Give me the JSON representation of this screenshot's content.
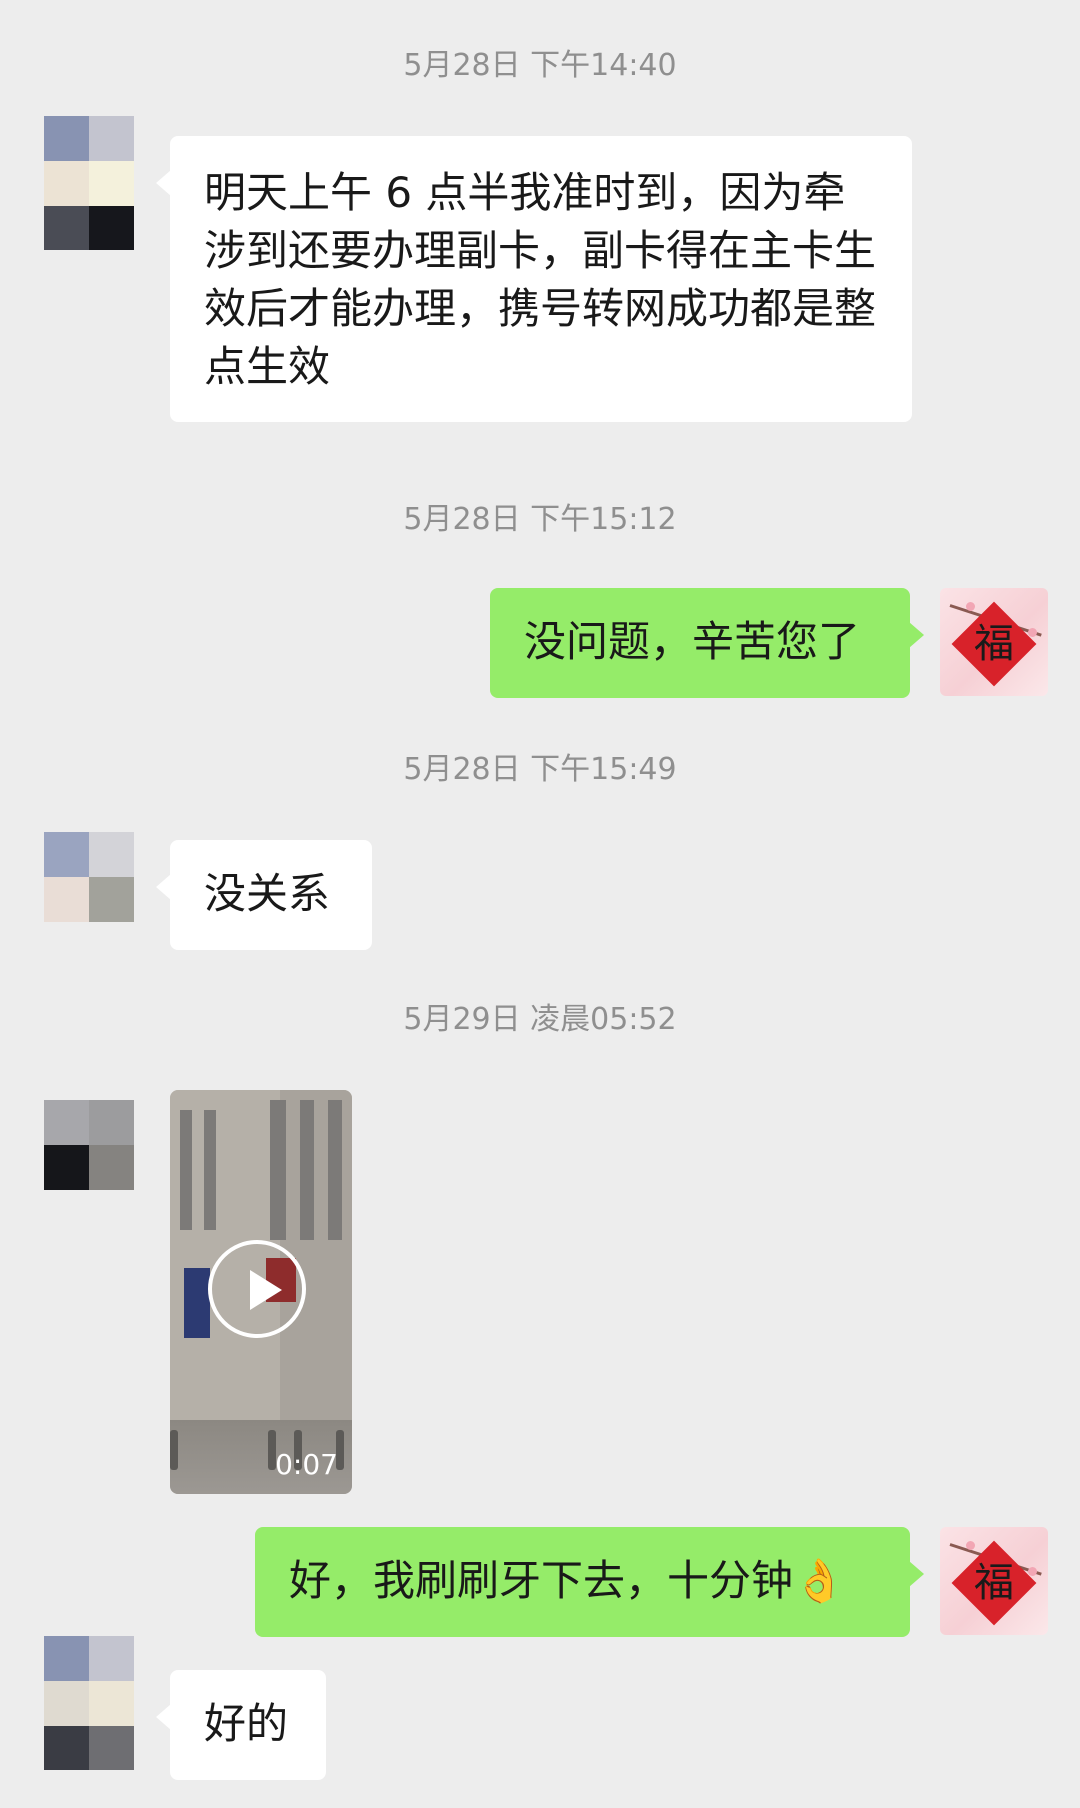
{
  "messages": [
    {
      "timestamp": "5月28日 下午14:40",
      "text": "明天上午 6 点半我准时到，因为牵涉到还要办理副卡，副卡得在主卡生效后才能办理，携号转网成功都是整点生效"
    },
    {
      "timestamp": "5月28日 下午15:12",
      "text": "没问题，辛苦您了"
    },
    {
      "timestamp": "5月28日 下午15:49",
      "text": "没关系"
    },
    {
      "timestamp": "5月29日 凌晨05:52",
      "video_duration": "0:07"
    },
    {
      "text": "好，我刷刷牙下去，十分钟👌"
    },
    {
      "text": "好的"
    }
  ],
  "self_avatar": {
    "char": "福",
    "icon": "fu-blessing-avatar"
  },
  "colors": {
    "incoming": "#ffffff",
    "outgoing": "#95ec69",
    "background": "#ededed",
    "timestamp": "#8f8f8f"
  }
}
